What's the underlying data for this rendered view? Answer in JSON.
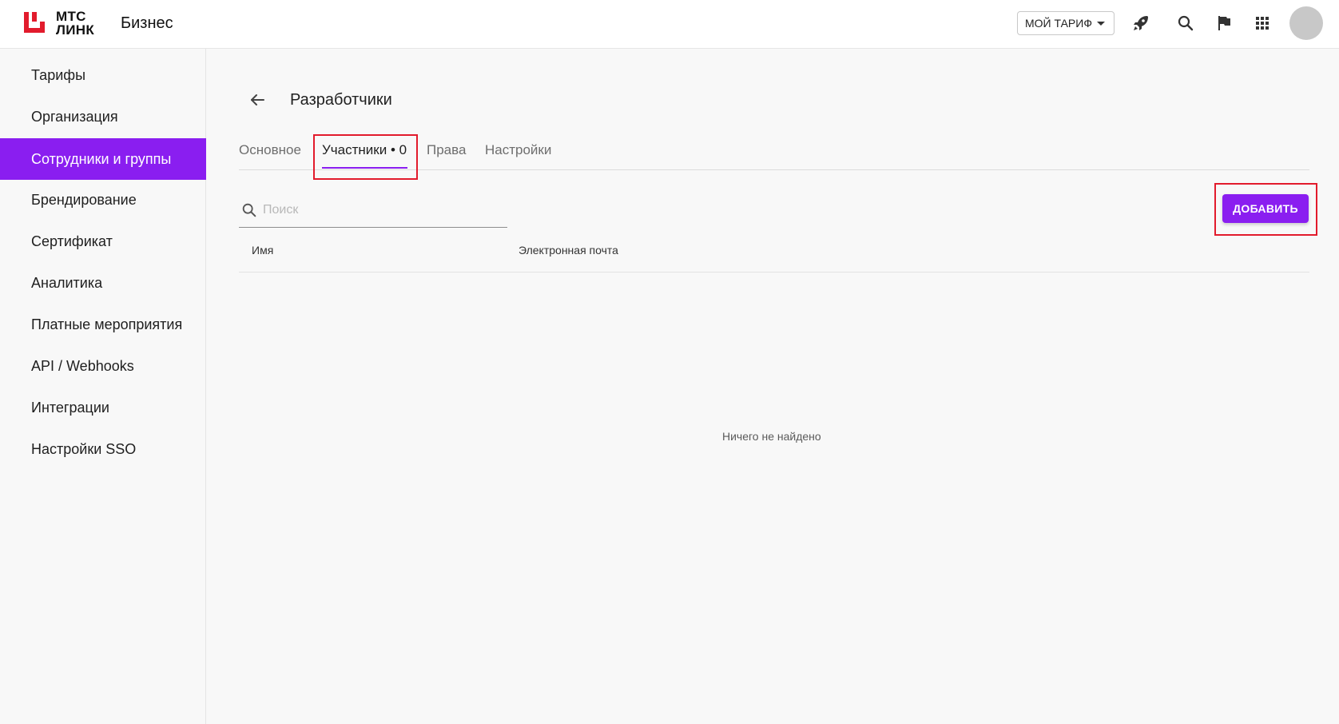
{
  "header": {
    "logo_line1": "МТС",
    "logo_line2": "ЛИНК",
    "app_name": "Бизнес",
    "tariff_label": "МОЙ ТАРИФ",
    "icons": [
      "rocket-icon",
      "search-icon",
      "flag-icon",
      "apps-grid-icon",
      "avatar"
    ],
    "brand_color": "#e21b2c"
  },
  "sidebar": {
    "items": [
      {
        "label": "Тарифы"
      },
      {
        "label": "Организация"
      },
      {
        "label": "Сотрудники и группы",
        "active": true
      },
      {
        "label": "Брендирование"
      },
      {
        "label": "Сертификат"
      },
      {
        "label": "Аналитика"
      },
      {
        "label": "Платные мероприятия"
      },
      {
        "label": "API / Webhooks"
      },
      {
        "label": "Интеграции"
      },
      {
        "label": "Настройки SSO"
      }
    ],
    "active_color": "#8a1ef0"
  },
  "main": {
    "title": "Разработчики",
    "tabs": [
      {
        "label": "Основное"
      },
      {
        "label": "Участники • 0",
        "active": true
      },
      {
        "label": "Права"
      },
      {
        "label": "Настройки"
      }
    ],
    "search": {
      "placeholder": "Поиск",
      "value": ""
    },
    "add_label": "ДОБАВИТЬ",
    "columns": [
      "Имя",
      "Электронная почта"
    ],
    "empty_text": "Ничего не найдено",
    "accent_color": "#8a1ef0",
    "highlight_color": "#e21b2c"
  }
}
